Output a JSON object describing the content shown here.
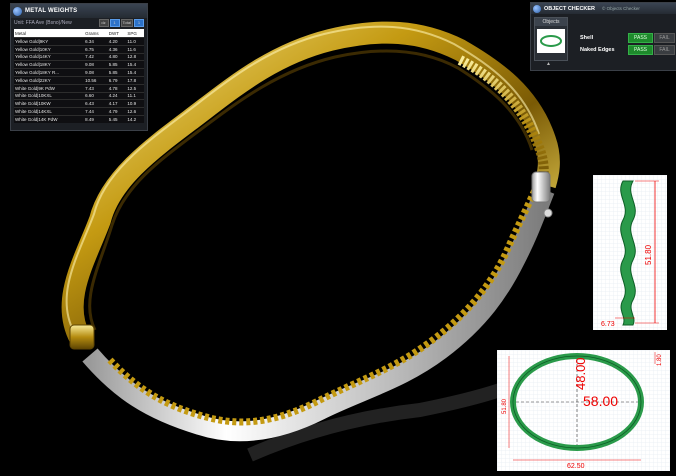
{
  "metal_weights": {
    "title": "METAL WEIGHTS",
    "unit_label": "Unit: FFA Ave (Bsno)/New",
    "controls": [
      "dz",
      "1",
      "Total",
      "1"
    ],
    "columns": [
      "Metal",
      "Grams",
      "DWT",
      "SPG"
    ],
    "rows": [
      [
        "Yellow Gold|9KY",
        "6.34",
        "4.20",
        "11.0"
      ],
      [
        "Yellow Gold|10KY",
        "6.75",
        "4.36",
        "11.6"
      ],
      [
        "Yellow Gold|14KY",
        "7.42",
        "4.80",
        "12.8"
      ],
      [
        "Yellow Gold|18KY",
        "9.08",
        "5.85",
        "15.4"
      ],
      [
        "Yellow Gold|18KY R...",
        "9.08",
        "5.85",
        "15.4"
      ],
      [
        "Yellow Gold|22KY",
        "10.56",
        "6.79",
        "17.8"
      ],
      [
        "White Gold|9K PdW",
        "7.43",
        "4.78",
        "12.5"
      ],
      [
        "White Gold|10KXL",
        "6.60",
        "4.24",
        "11.1"
      ],
      [
        "White Gold|10KW",
        "6.43",
        "4.17",
        "10.9"
      ],
      [
        "White Gold|14KXL",
        "7.44",
        "4.79",
        "12.6"
      ],
      [
        "White Gold|14K PdW",
        "8.49",
        "5.45",
        "14.2"
      ]
    ]
  },
  "object_checker": {
    "title": "OBJECT CHECKER",
    "byline": "© Objects Checker",
    "objects_label": "Objects",
    "checks": [
      {
        "label": "Shell",
        "pass": "PASS",
        "fail": "FAIL"
      },
      {
        "label": "Naked Edges",
        "pass": "PASS",
        "fail": "FAIL"
      }
    ]
  },
  "dimensions": {
    "side_height": "51.80",
    "side_width": "6.73",
    "top_inner": "48.00",
    "top_inner_width": "58.00",
    "top_thickness": "1.80",
    "top_outer_height": "51.80",
    "top_outer_width": "62.50"
  },
  "colors": {
    "gold": "#c9a21a",
    "white_metal": "#d8d8d8",
    "pass_green": "#1e8a2c",
    "dimension_red": "#e00000",
    "ring_green": "#2a9a4a"
  }
}
